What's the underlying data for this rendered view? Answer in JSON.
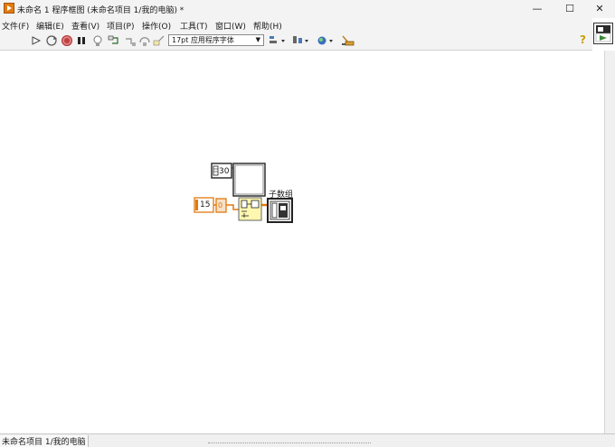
{
  "window": {
    "title": "未命名 1 程序框图 (未命名项目 1/我的电脑)  *",
    "controls": {
      "minimize": "—",
      "maximize": "☐",
      "close": "✕"
    }
  },
  "menu": [
    "文件(F)",
    "编辑(E)",
    "查看(V)",
    "项目(P)",
    "操作(O)",
    "工具(T)",
    "窗口(W)",
    "帮助(H)"
  ],
  "toolbar": {
    "font": "17pt 应用程序字体",
    "icons": [
      "run-arrow-icon",
      "run-continuously-icon",
      "abort-icon",
      "pause-icon",
      "highlight-execution-icon",
      "retain-wire-values-icon",
      "step-into-icon",
      "step-over-icon",
      "step-out-icon",
      "align-objects-icon",
      "distribute-objects-icon",
      "reorder-icon",
      "clean-up-diagram-icon"
    ],
    "help_icon": "?"
  },
  "diagram": {
    "const_30": "30",
    "const_15": "15",
    "const_0": "0",
    "subarray_label": "子数组"
  },
  "status": {
    "project": "未命名项目 1/我的电脑"
  }
}
